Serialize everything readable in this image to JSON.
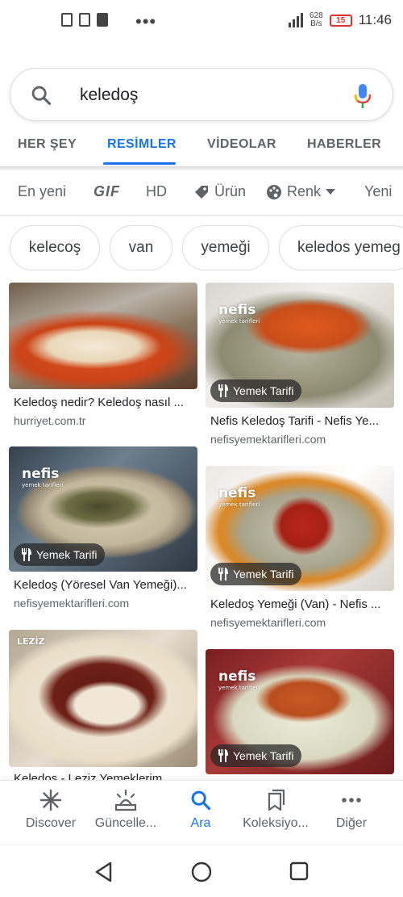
{
  "status_bar": {
    "network_speed_value": "628",
    "network_speed_unit": "B/s",
    "battery": "15",
    "time": "11:46",
    "dots": "•••"
  },
  "search": {
    "query": "keledoş"
  },
  "tabs": [
    {
      "label": "HER ŞEY",
      "active": false
    },
    {
      "label": "RESİMLER",
      "active": true
    },
    {
      "label": "VİDEOLAR",
      "active": false
    },
    {
      "label": "HABERLER",
      "active": false
    }
  ],
  "filters": [
    {
      "label": "En yeni",
      "icon": ""
    },
    {
      "label": "GIF",
      "icon": ""
    },
    {
      "label": "HD",
      "icon": ""
    },
    {
      "label": "Ürün",
      "icon": "tag-icon"
    },
    {
      "label": "Renk",
      "icon": "palette-icon"
    },
    {
      "label": "Yeni",
      "icon": ""
    }
  ],
  "suggestions": [
    "kelecoş",
    "van",
    "yemeği",
    "keledos yemeg"
  ],
  "results": [
    {
      "title": "Keledoş nedir? Keledoş nasıl ...",
      "source": "hurriyet.com.tr",
      "badge": ""
    },
    {
      "title": "Nefis Keledoş Tarifi - Nefis Ye...",
      "source": "nefisyemektarifleri.com",
      "badge": "Yemek Tarifi"
    },
    {
      "title": "Keledoş (Yöresel Van Yemeği)...",
      "source": "nefisyemektarifleri.com",
      "badge": "Yemek Tarifi"
    },
    {
      "title": "Keledoş Yemeği (Van) - Nefis ...",
      "source": "nefisyemektarifleri.com",
      "badge": "Yemek Tarifi"
    },
    {
      "title": "Keledos - Leziz Yemeklerim",
      "source": "",
      "badge": ""
    },
    {
      "title": "",
      "source": "",
      "badge": "Yemek Tarifi"
    }
  ],
  "image_overlays": {
    "nefis_logo": "nefis",
    "nefis_logo_sub": "yemek tarifleri",
    "leziz_logo": "LEZİZ"
  },
  "bottom_nav": [
    {
      "label": "Discover",
      "icon": "asterisk-icon",
      "active": false
    },
    {
      "label": "Güncelle...",
      "icon": "updates-icon",
      "active": false
    },
    {
      "label": "Ara",
      "icon": "search-icon",
      "active": true
    },
    {
      "label": "Koleksiyo...",
      "icon": "bookmarks-icon",
      "active": false
    },
    {
      "label": "Diğer",
      "icon": "more-dots-icon",
      "active": false
    }
  ],
  "colors": {
    "accent": "#1a73e8",
    "text_secondary": "#5f6368",
    "battery_low": "#dd3333"
  }
}
